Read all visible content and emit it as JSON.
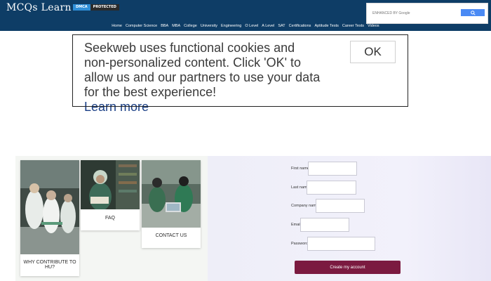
{
  "header": {
    "logo": "MCQs Learn",
    "badge_dmca": "DMCA",
    "badge_protected": "PROTECTED",
    "search": {
      "placeholder": "ENHANCED BY Google"
    }
  },
  "nav": {
    "items": [
      "Home",
      "Computer Science",
      "BBA",
      "MBA",
      "College",
      "University",
      "Engineering",
      "O Level",
      "A Level",
      "SAT",
      "Certifications",
      "Aptitude Tests",
      "Career Tests",
      "Videos"
    ]
  },
  "cookie": {
    "message": "Seekweb uses functional cookies and non-personalized content. Click 'OK' to allow us and our partners to use your data for the best experience!",
    "learn_more": "Learn more",
    "ok_label": "OK"
  },
  "cards": [
    {
      "label": "WHY CONTRIBUTE TO HU?",
      "icon": "lab-photo"
    },
    {
      "label": "FAQ",
      "icon": "library-photo"
    },
    {
      "label": "CONTACT US",
      "icon": "students-photo"
    }
  ],
  "form": {
    "first_name": "First name",
    "last_name": "Last name",
    "company_name": "Company name",
    "email": "Email",
    "password": "Password",
    "submit": "Create my account"
  },
  "colors": {
    "header_bg": "#0e3d66",
    "button_bg": "#7b1a40",
    "learn_more": "#1a3f86"
  }
}
